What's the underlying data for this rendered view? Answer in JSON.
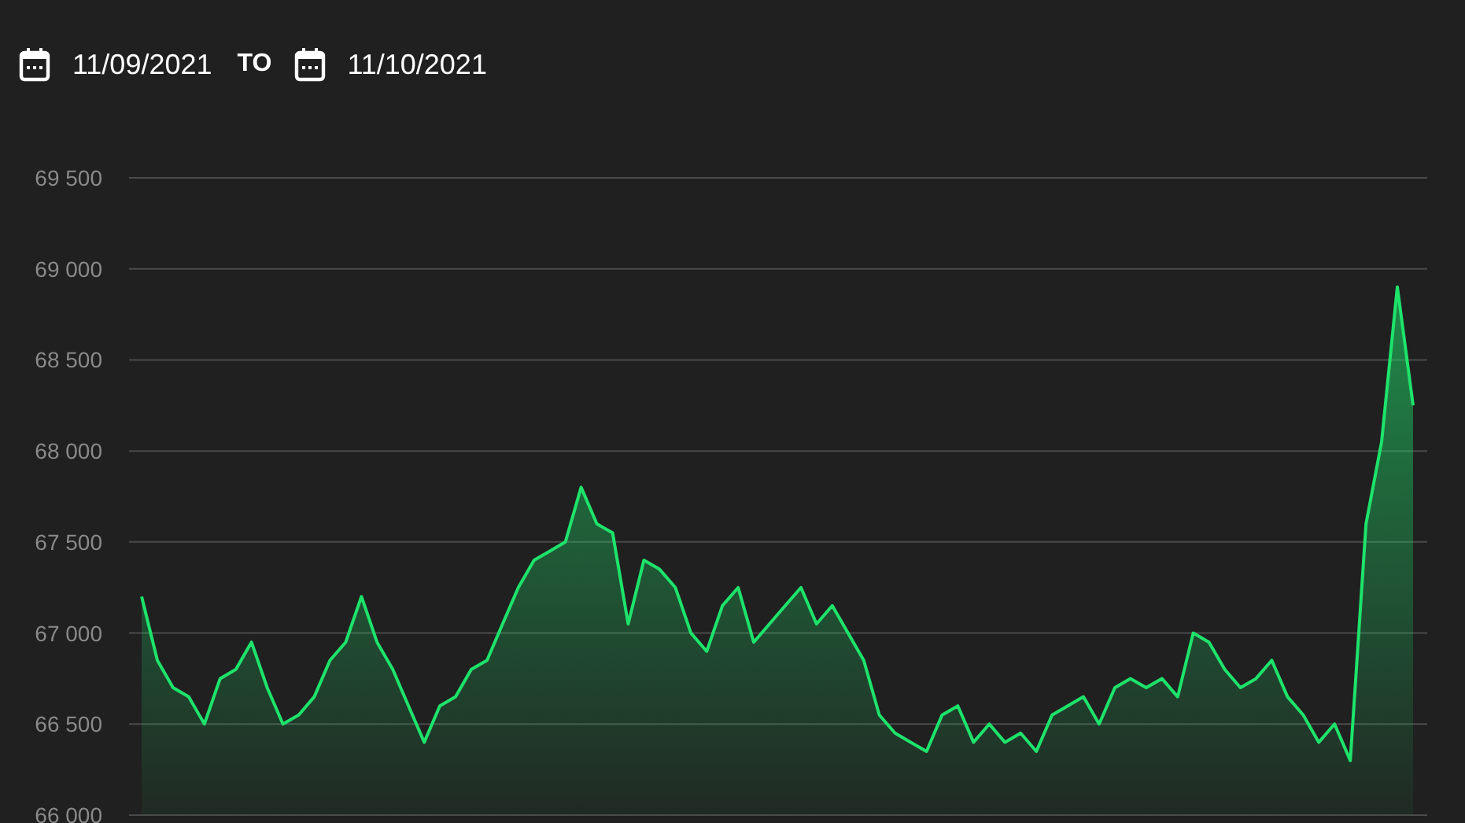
{
  "date_range": {
    "start_date": "11/09/2021",
    "separator": "TO",
    "end_date": "11/10/2021"
  },
  "price_chart": {
    "chart_data": {
      "type": "area",
      "grid": true,
      "ylim": [
        66000,
        69500
      ],
      "yticks": [
        {
          "value": 69500,
          "label": "69 500"
        },
        {
          "value": 69000,
          "label": "69 000"
        },
        {
          "value": 68500,
          "label": "68 500"
        },
        {
          "value": 68000,
          "label": "68 000"
        },
        {
          "value": 67500,
          "label": "67 500"
        },
        {
          "value": 67000,
          "label": "67 000"
        },
        {
          "value": 66500,
          "label": "66 500"
        },
        {
          "value": 66000,
          "label": "66 000"
        }
      ],
      "series": [
        {
          "color": "#1ee36b",
          "values": [
            67200,
            66850,
            66700,
            66650,
            66500,
            66750,
            66800,
            66950,
            66700,
            66500,
            66550,
            66650,
            66850,
            66950,
            67200,
            66950,
            66800,
            66600,
            66400,
            66600,
            66650,
            66800,
            66850,
            67050,
            67250,
            67400,
            67450,
            67500,
            67800,
            67600,
            67550,
            67050,
            67400,
            67350,
            67250,
            67000,
            66900,
            67150,
            67250,
            66950,
            67050,
            67150,
            67250,
            67050,
            67150,
            67000,
            66850,
            66550,
            66450,
            66400,
            66350,
            66550,
            66600,
            66400,
            66500,
            66400,
            66450,
            66350,
            66550,
            66600,
            66650,
            66500,
            66700,
            66750,
            66700,
            66750,
            66650,
            67000,
            66950,
            66800,
            66700,
            66750,
            66850,
            66650,
            66550,
            66400,
            66500,
            66300,
            67600,
            68050,
            68900,
            68250
          ]
        }
      ]
    }
  }
}
